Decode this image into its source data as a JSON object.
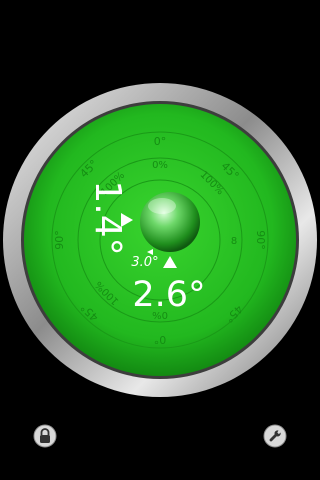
{
  "level": {
    "outer_scale": {
      "top": "0°",
      "top_left": "45°",
      "top_right": "45°",
      "left": "90°",
      "right": "90°",
      "bottom_left": "45°",
      "bottom_right": "45°",
      "bottom": "0°"
    },
    "inner_scale": {
      "top": "0%",
      "top_right": "100%",
      "top_left": "100%",
      "right": "8",
      "bottom_left": "100%",
      "bottom": "0%"
    },
    "vertical_angle": "1.4°",
    "horizontal_angle": "2.6°",
    "small_angle": "3.0°"
  },
  "controls": {
    "lock_icon": "lock-icon",
    "settings_icon": "wrench-icon"
  },
  "colors": {
    "background": "#000000",
    "face": "#22c022",
    "bezel": "#c8c8c8",
    "text": "#ffffff"
  }
}
